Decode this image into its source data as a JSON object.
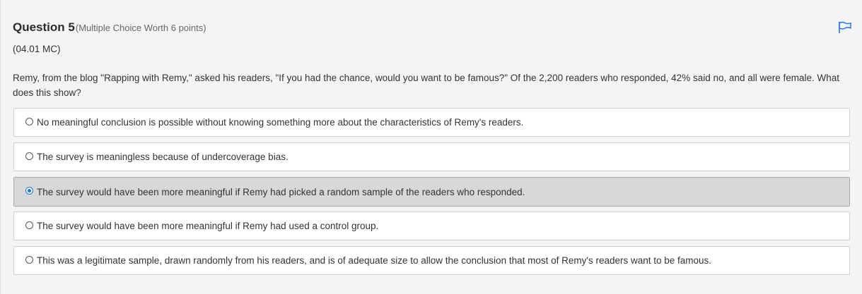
{
  "question": {
    "title": "Question 5",
    "worth": "(Multiple Choice Worth 6 points)",
    "code": "(04.01 MC)",
    "stem": "Remy, from the blog \"Rapping with Remy,\" asked his readers, \"If you had the chance, would you want to be famous?\" Of the 2,200 readers who responded, 42% said no, and all were female. What does this show?"
  },
  "flag_icon": "flag-icon",
  "colors": {
    "accent": "#1a73e8",
    "selected_bg": "#d8d8da"
  },
  "options": [
    {
      "label": "No meaningful conclusion is possible without knowing something more about the characteristics of Remy's readers.",
      "selected": false
    },
    {
      "label": "The survey is meaningless because of undercoverage bias.",
      "selected": false
    },
    {
      "label": "The survey would have been more meaningful if Remy had picked a random sample of the readers who responded.",
      "selected": true
    },
    {
      "label": "The survey would have been more meaningful if Remy had used a control group.",
      "selected": false
    },
    {
      "label": "This was a legitimate sample, drawn randomly from his readers, and is of adequate size to allow the conclusion that most of Remy's readers want to be famous.",
      "selected": false
    }
  ]
}
